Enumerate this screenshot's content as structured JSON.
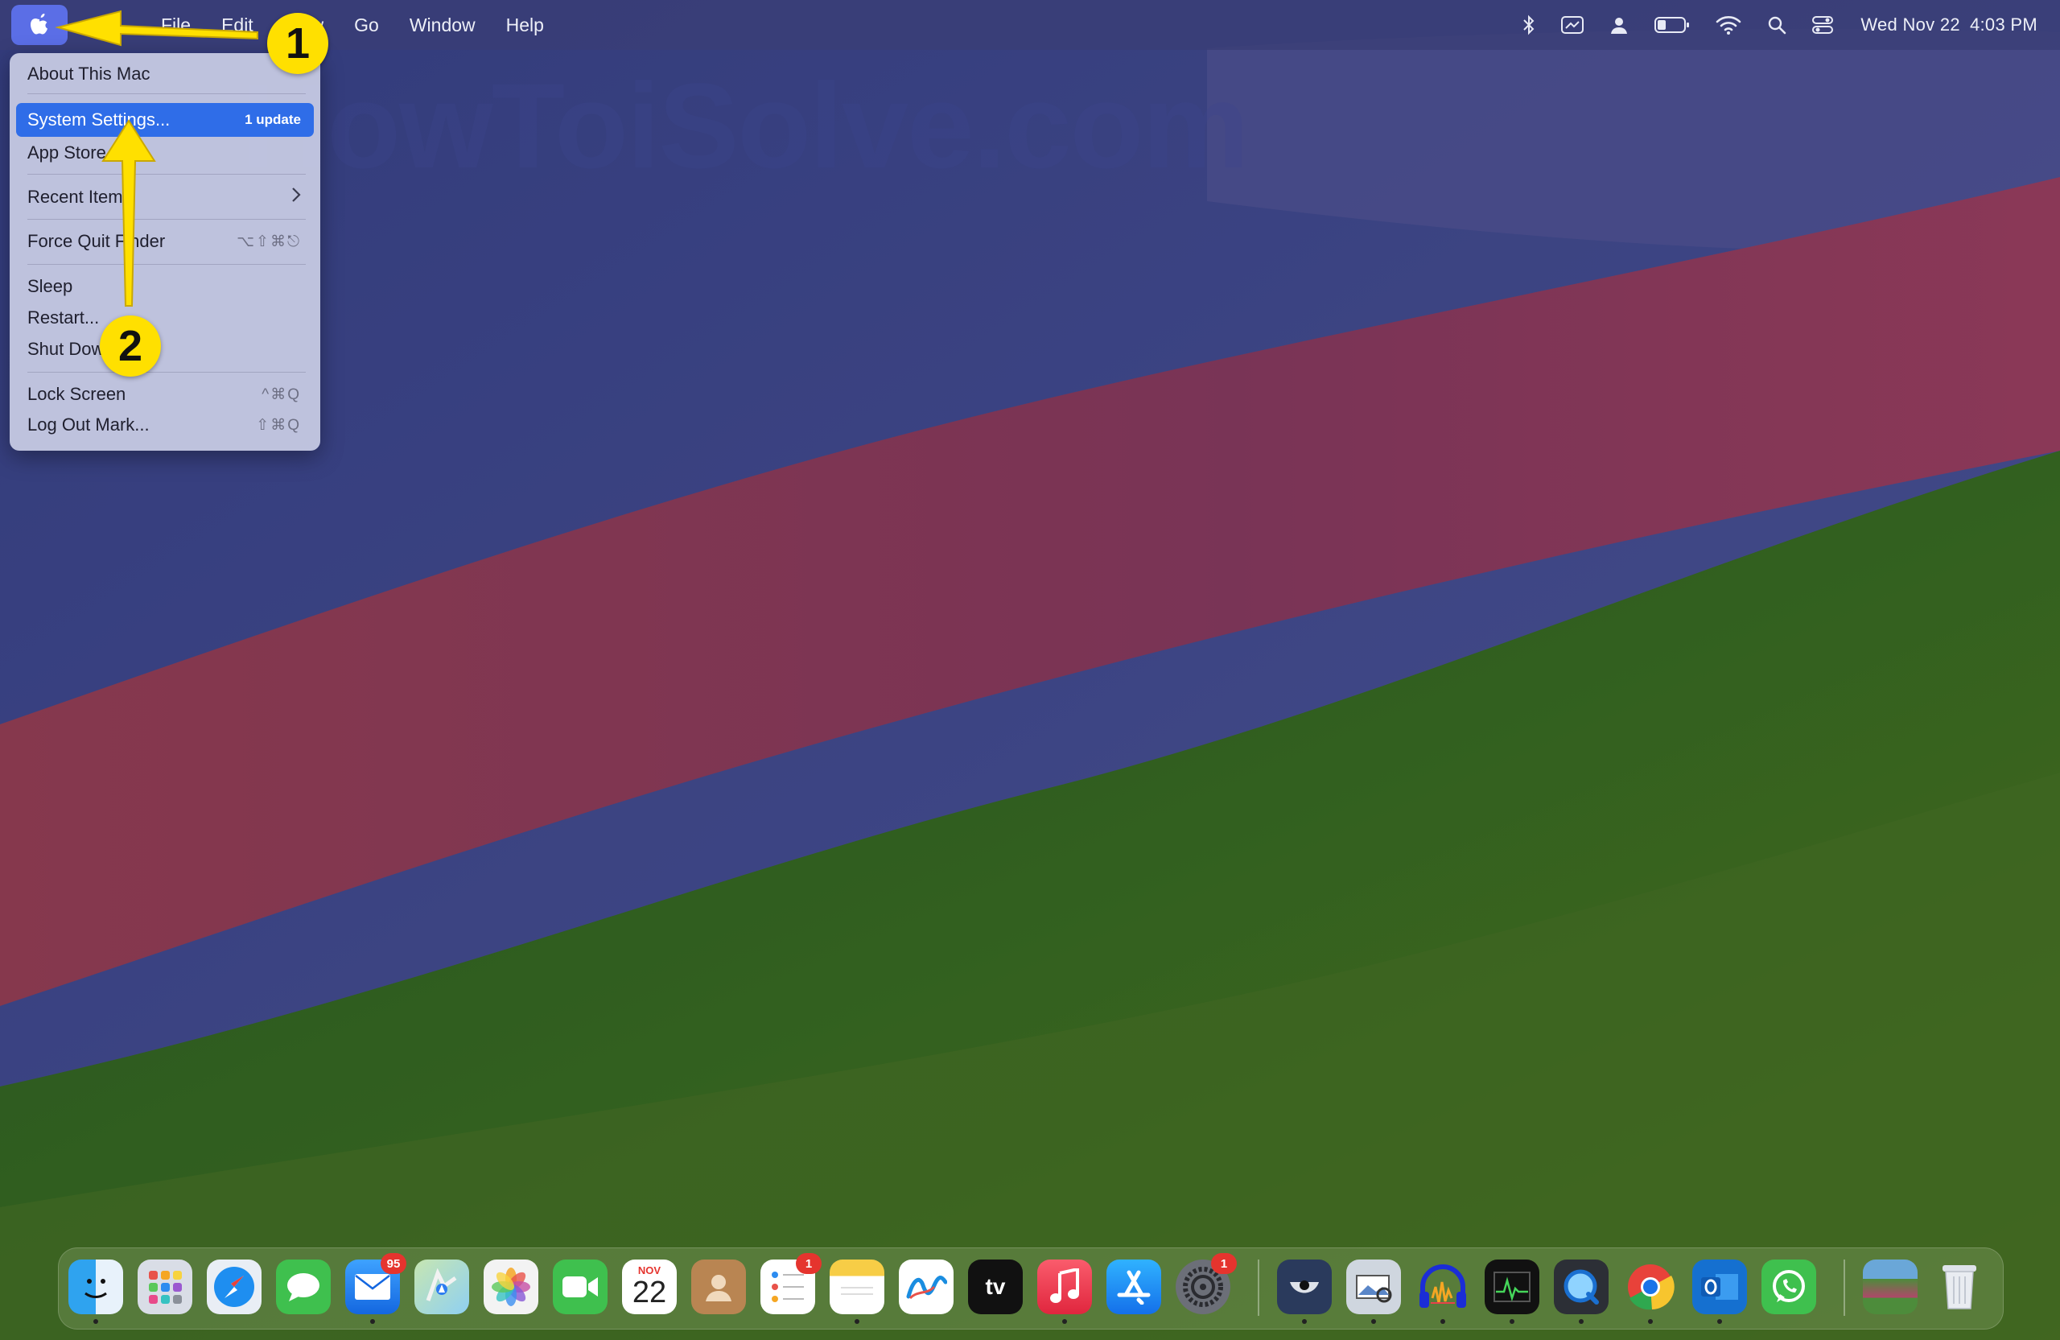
{
  "menubar": {
    "apple_icon": "apple-logo-icon",
    "menus": [
      "File",
      "Edit",
      "View",
      "Go",
      "Window",
      "Help"
    ],
    "status_icons": [
      "bluetooth-icon",
      "screenshot-icon",
      "user-icon",
      "battery-icon",
      "wifi-icon",
      "search-icon",
      "control-center-icon"
    ],
    "date": "Wed Nov 22",
    "time": "4:03 PM"
  },
  "apple_menu": {
    "about": "About This Mac",
    "settings": "System Settings...",
    "settings_badge": "1 update",
    "app_store": "App Store",
    "recent": "Recent Items",
    "force_quit": "Force Quit Finder",
    "force_quit_shortcut": "⌥⇧⌘⎋",
    "sleep": "Sleep",
    "restart": "Restart...",
    "shutdown": "Shut Down...",
    "lock": "Lock Screen",
    "lock_shortcut": "^⌘Q",
    "logout": "Log Out Mark...",
    "logout_shortcut": "⇧⌘Q"
  },
  "annotations": {
    "step1": "1",
    "step2": "2",
    "watermark": "HowToiSolve.com",
    "arrow_color": "#ffe000"
  },
  "dock": {
    "mail_badge": "95",
    "reminders_badge": "1",
    "settings_badge": "1",
    "calendar_month": "NOV",
    "calendar_day": "22",
    "tv_label": "tv",
    "icons": [
      "finder-icon",
      "launchpad-icon",
      "safari-icon",
      "messages-icon",
      "mail-icon",
      "maps-icon",
      "photos-icon",
      "facetime-icon",
      "calendar-icon",
      "contacts-icon",
      "reminders-icon",
      "notes-icon",
      "freeform-icon",
      "apple-tv-icon",
      "music-icon",
      "app-store-icon",
      "system-settings-icon",
      "cleaner-icon",
      "preview-icon",
      "audio-icon",
      "activity-monitor-icon",
      "quicktime-icon",
      "chrome-icon",
      "outlook-icon",
      "whatsapp-icon",
      "folder-icon",
      "trash-icon"
    ]
  }
}
